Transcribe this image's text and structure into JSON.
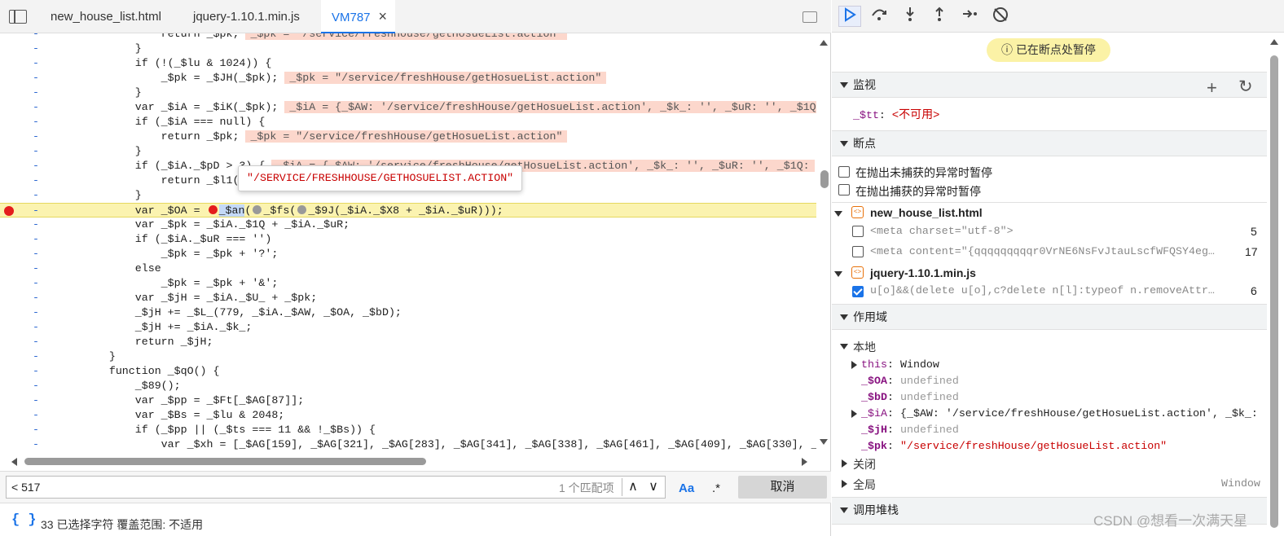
{
  "tabs": [
    {
      "label": "new_house_list.html"
    },
    {
      "label": "jquery-1.10.1.min.js"
    },
    {
      "label": "VM787",
      "close": "×"
    }
  ],
  "code_lines": [
    {
      "gutter": "-",
      "code": "                return _$pk;",
      "inline": "_$pk = \"/service/freshHouse/getHosueList.action\""
    },
    {
      "gutter": "-",
      "code": "            }"
    },
    {
      "gutter": "-",
      "code": "            if (!(_$lu & 1024)) {"
    },
    {
      "gutter": "-",
      "code": "                _$pk = _$JH(_$pk);",
      "inline": "_$pk = \"/service/freshHouse/getHosueList.action\""
    },
    {
      "gutter": "-",
      "code": "            }"
    },
    {
      "gutter": "-",
      "code": "            var _$iA = _$iK(_$pk);",
      "inline": "_$iA = {_$AW: '/service/freshHouse/getHosueList.action', _$k_: '', _$uR: '', _$1Q"
    },
    {
      "gutter": "-",
      "code": "            if (_$iA === null) {"
    },
    {
      "gutter": "-",
      "code": "                return _$pk;",
      "inline": "_$pk = \"/service/freshHouse/getHosueList.action\""
    },
    {
      "gutter": "-",
      "code": "            }"
    },
    {
      "gutter": "-",
      "code": "            if (_$iA._$pD > 3) {",
      "inline": "_$iA = {_$AW: '/service/freshHouse/getHosueList.action', _$k_: '', _$uR: '', _$1Q:"
    },
    {
      "gutter": "-",
      "code": "                return _$l1(_$"
    },
    {
      "gutter": "-",
      "code": "            }"
    },
    {
      "gutter": "-",
      "code": "            var _$OA = ",
      "highlight": true
    },
    {
      "gutter": "-",
      "code": "            var _$pk = _$iA._$1Q + _$iA._$uR;"
    },
    {
      "gutter": "-",
      "code": "            if (_$iA._$uR === '')"
    },
    {
      "gutter": "-",
      "code": "                _$pk = _$pk + '?';"
    },
    {
      "gutter": "-",
      "code": "            else"
    },
    {
      "gutter": "-",
      "code": "                _$pk = _$pk + '&';"
    },
    {
      "gutter": "-",
      "code": "            var _$jH = _$iA._$U_ + _$pk;"
    },
    {
      "gutter": "-",
      "code": "            _$jH += _$L_(779, _$iA._$AW, _$OA, _$bD);"
    },
    {
      "gutter": "-",
      "code": "            _$jH += _$iA._$k_;"
    },
    {
      "gutter": "-",
      "code": "            return _$jH;"
    },
    {
      "gutter": "-",
      "code": "        }"
    },
    {
      "gutter": "-",
      "code": "        function _$qO() {"
    },
    {
      "gutter": "-",
      "code": "            _$89();"
    },
    {
      "gutter": "-",
      "code": "            var _$pp = _$Ft[_$AG[87]];"
    },
    {
      "gutter": "-",
      "code": "            var _$Bs = _$lu & 2048;"
    },
    {
      "gutter": "-",
      "code": "            if (_$pp || (_$ts === 11 && !_$Bs)) {"
    },
    {
      "gutter": "-",
      "code": "                var _$xh = [_$AG[159], _$AG[321], _$AG[283], _$AG[341], _$AG[338], _$AG[461], _$AG[409], _$AG[330], _"
    }
  ],
  "highlight_line": {
    "prefix": "            var _$OA = ",
    "call1": "_$an",
    "mid1": "(",
    "call2": "_$fs(",
    "rest": "_$9J(_$iA._$X8 + _$iA._$uR))",
    "tail": ");"
  },
  "tooltip": "\"/SERVICE/FRESHHOUSE/GETHOSUELIST.ACTION\"",
  "search": {
    "value": "< 517",
    "match_count": "1 个匹配项",
    "up": "∧",
    "down": "∨",
    "case_opt": "Aa",
    "regex_opt": ".*",
    "cancel": "取消"
  },
  "status": {
    "pretty": "{ }",
    "text": "33 已选择字符    覆盖范围: 不适用"
  },
  "paused_text": "已在断点处暂停",
  "watch": {
    "title": "监视",
    "expr_name": "_$tt",
    "expr_value": "<不可用>"
  },
  "breakpoints": {
    "title": "断点",
    "uncaught": "在抛出未捕获的异常时暂停",
    "caught": "在抛出捕获的异常时暂停",
    "files": [
      {
        "name": "new_house_list.html",
        "items": [
          {
            "text": "<meta charset=\"utf-8\">",
            "line": "5",
            "checked": false
          },
          {
            "text": "<meta content=\"{qqqqqqqqqr0VrNE6NsFvJtauLscfWFQSY4eg…",
            "line": "17",
            "checked": false
          }
        ]
      },
      {
        "name": "jquery-1.10.1.min.js",
        "items": [
          {
            "text": "u[o]&&(delete u[o],c?delete n[l]:typeof n.removeAttr…",
            "line": "6",
            "checked": true
          }
        ]
      }
    ]
  },
  "scope": {
    "title": "作用域",
    "local": "本地",
    "vars": [
      {
        "name": "this",
        "value": "Window",
        "expandable": true,
        "kind": "plain"
      },
      {
        "name": "_$OA",
        "value": "undefined",
        "expandable": false,
        "kind": "undef"
      },
      {
        "name": "_$bD",
        "value": "undefined",
        "expandable": false,
        "kind": "undef"
      },
      {
        "name": "_$iA",
        "value": "{_$AW: '/service/freshHouse/getHosueList.action', _$k_:",
        "expandable": true,
        "kind": "obj"
      },
      {
        "name": "_$jH",
        "value": "undefined",
        "expandable": false,
        "kind": "undef"
      },
      {
        "name": "_$pk",
        "value": "\"/service/freshHouse/getHosueList.action\"",
        "expandable": false,
        "kind": "str"
      }
    ],
    "closure": "关闭",
    "global": "全局",
    "global_value": "Window"
  },
  "callstack": {
    "title": "调用堆栈"
  },
  "watermark": "CSDN @想看一次满天星",
  "colors": {
    "accent": "#1a73e8",
    "breakpoint": "#e41d1d",
    "highlight": "#fbf3b0",
    "paused_badge": "#fbf2a6"
  }
}
